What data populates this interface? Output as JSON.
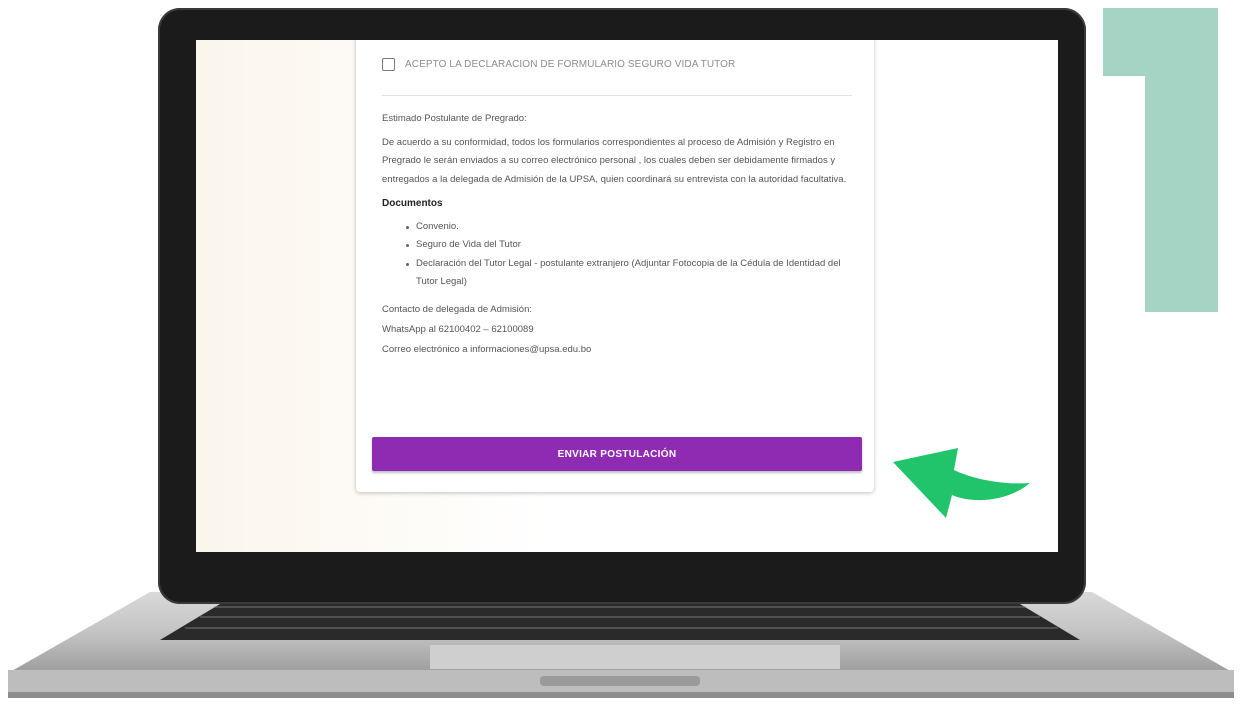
{
  "step": {
    "number": "1",
    "color": "#a5d3c4"
  },
  "form": {
    "consent_label": "ACEPTO LA DECLARACION DE FORMULARIO SEGURO VIDA TUTOR",
    "greeting": "Estimado Postulante de Pregrado:",
    "paragraph": "De acuerdo a su conformidad, todos los formularios correspondientes al proceso de Admisión y Registro en Pregrado le serán enviados a su correo electrónico personal , los cuales deben ser debidamente firmados y entregados a la delegada de Admisión de la UPSA, quien coordinará su entrevista con la autoridad facultativa.",
    "documents_title": "Documentos",
    "documents": [
      "Convenio.",
      "Seguro de Vida del Tutor",
      "Declaración del Tutor Legal - postulante extranjero (Adjuntar Fotocopia de la Cédula de Identidad del Tutor Legal)"
    ],
    "contact_title": "Contacto de delegada de Admisión:",
    "contact_whatsapp": "WhatsApp al 62100402 – 62100089",
    "contact_email": "Correo electrónico a informaciones@upsa.edu.bo",
    "submit_label": "ENVIAR POSTULACIÓN"
  },
  "colors": {
    "button": "#8f2bb3",
    "arrow": "#21c36b"
  },
  "icons": {
    "pointer": "curved-arrow-icon"
  }
}
